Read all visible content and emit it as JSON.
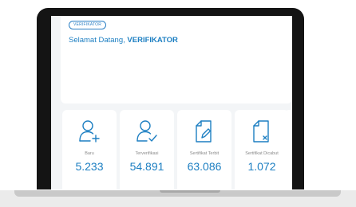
{
  "header": {
    "role_badge": "VERIFIKATOR",
    "welcome_prefix": "Selamat Datang, ",
    "welcome_name": "VERIFIKATOR"
  },
  "stats": [
    {
      "label": "Baru",
      "value": "5.233",
      "icon": "user-add-icon"
    },
    {
      "label": "Terverifikasi",
      "value": "54.891",
      "icon": "user-check-icon"
    },
    {
      "label": "Sertifikat Terbit",
      "value": "63.086",
      "icon": "document-edit-icon"
    },
    {
      "label": "Sertifikat Dicabut",
      "value": "1.072",
      "icon": "document-revoke-icon"
    }
  ],
  "colors": {
    "accent": "#1d7fc2",
    "label": "#8a8a8a",
    "bezel": "#141414",
    "screen_bg": "#f3f5f7"
  }
}
